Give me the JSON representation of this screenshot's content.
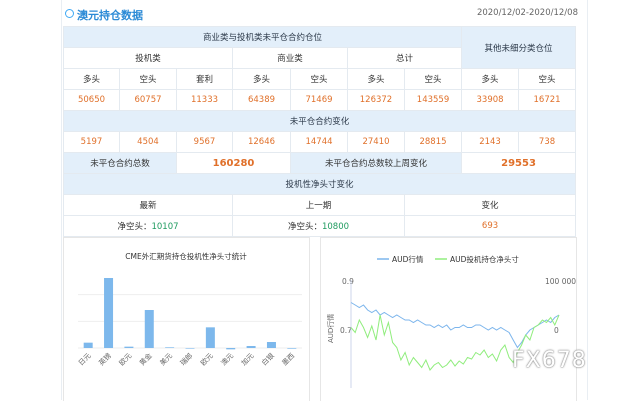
{
  "header": {
    "title": "澳元持仓数据",
    "date_range": "2020/12/02-2020/12/08"
  },
  "table": {
    "top_header": "商业类与投机类未平仓合约仓位",
    "other_header": "其他未细分类仓位",
    "groups": [
      "投机类",
      "商业类",
      "总计"
    ],
    "cols": [
      "多头",
      "空头",
      "套利",
      "多头",
      "空头",
      "多头",
      "空头",
      "多头",
      "空头"
    ],
    "values": [
      "50650",
      "60757",
      "11333",
      "64389",
      "71469",
      "126372",
      "143559",
      "33908",
      "16721"
    ],
    "change_header": "未平仓合约变化",
    "change_values": [
      "5197",
      "4504",
      "9567",
      "12646",
      "14744",
      "27410",
      "28815",
      "2143",
      "738"
    ],
    "total_label": "未平仓合约总数",
    "total_value": "160280",
    "week_change_label": "未平仓合约总数较上周变化",
    "week_change_value": "29553",
    "spec_header": "投机性净头寸变化",
    "spec_cols": [
      "最新",
      "上一期",
      "变化"
    ],
    "spec_latest_label": "净空头：",
    "spec_latest_value": "10107",
    "spec_prev_label": "净空头：",
    "spec_prev_value": "10800",
    "spec_change": "693"
  },
  "chart_data": [
    {
      "type": "bar",
      "title": "CME外汇期货持仓投机性净头寸统计",
      "categories": [
        "日元",
        "英镑",
        "欧元",
        "黄金",
        "美元",
        "瑞郎",
        "欧元",
        "澳元",
        "加元",
        "白银",
        "墨西"
      ],
      "values": [
        8,
        105,
        2,
        57,
        1,
        0,
        31,
        -2,
        3,
        9,
        -1
      ],
      "color": "#7db8ec"
    },
    {
      "type": "line",
      "series": [
        {
          "name": "AUD行情",
          "color": "#7cb5ec"
        },
        {
          "name": "AUD投机持仓净头寸",
          "color": "#90ed7d"
        }
      ],
      "ylabel": "AUD行情",
      "left_ticks": [
        "0.9",
        "0.7"
      ],
      "right_ticks": [
        "100 000",
        "0"
      ],
      "aud_values": [
        0.81,
        0.8,
        0.79,
        0.8,
        0.78,
        0.77,
        0.78,
        0.76,
        0.77,
        0.76,
        0.75,
        0.76,
        0.75,
        0.74,
        0.74,
        0.73,
        0.74,
        0.73,
        0.72,
        0.72,
        0.71,
        0.72,
        0.71,
        0.72,
        0.7,
        0.71,
        0.71,
        0.72,
        0.71,
        0.71,
        0.72,
        0.72,
        0.71,
        0.7,
        0.71,
        0.7,
        0.71,
        0.7,
        0.69,
        0.66,
        0.63,
        0.65,
        0.68,
        0.7,
        0.71,
        0.72,
        0.73,
        0.74,
        0.73,
        0.75,
        0.76
      ],
      "pos_values": [
        5,
        -5,
        20,
        5,
        -15,
        8,
        -20,
        30,
        -10,
        15,
        -25,
        -35,
        -60,
        -45,
        -70,
        -55,
        -65,
        -75,
        -60,
        -80,
        -70,
        -65,
        -75,
        -70,
        -60,
        -72,
        -62,
        -68,
        -55,
        -58,
        -45,
        -50,
        -40,
        -55,
        -48,
        -62,
        -40,
        -30,
        -55,
        -65,
        -45,
        -30,
        -10,
        -20,
        5,
        10,
        20,
        15,
        25,
        10,
        30
      ]
    }
  ],
  "watermark": "FX678"
}
